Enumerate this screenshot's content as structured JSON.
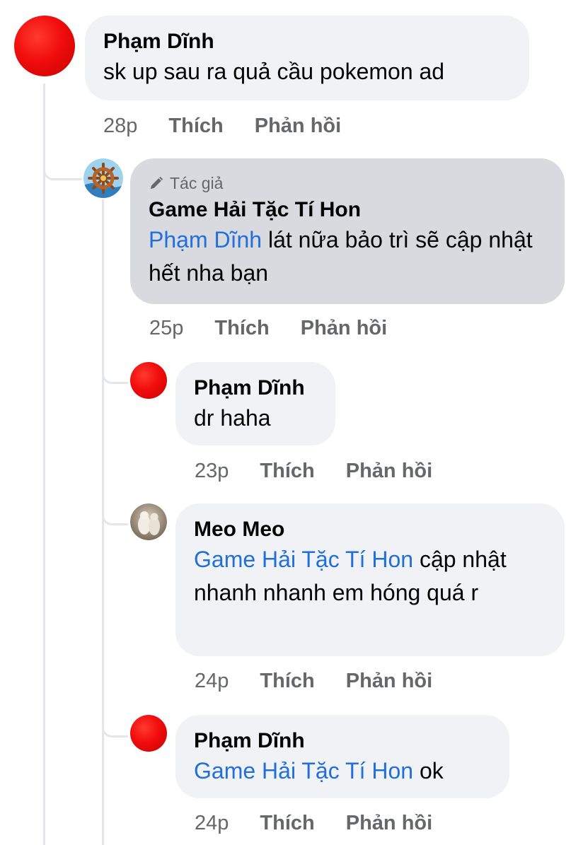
{
  "comments": [
    {
      "author": "Phạm Dĩnh",
      "text": "sk up sau ra quả cầu pokemon ad",
      "time": "28p",
      "like": "Thích",
      "reply": "Phản hồi"
    },
    {
      "badge": "Tác giả",
      "author": "Game Hải Tặc Tí Hon",
      "mention": "Phạm Dĩnh",
      "text": " lát nữa bảo trì sẽ cập nhật hết nha bạn",
      "time": "25p",
      "like": "Thích",
      "reply": "Phản hồi"
    },
    {
      "author": "Phạm Dĩnh",
      "text": "dr haha",
      "time": "23p",
      "like": "Thích",
      "reply": "Phản hồi"
    },
    {
      "author": "Meo Meo",
      "mention": "Game Hải Tặc Tí Hon",
      "text": " cập nhật nhanh nhanh em hóng quá r",
      "time": "24p",
      "like": "Thích",
      "reply": "Phản hồi"
    },
    {
      "author": "Phạm Dĩnh",
      "mention": "Game Hải Tặc Tí Hon",
      "text": " ok",
      "time": "24p",
      "like": "Thích",
      "reply": "Phản hồi"
    }
  ],
  "icons": {
    "badge": "pencil-icon",
    "page_avatar": "ship-wheel-logo",
    "user_avatar": "cat-photo"
  },
  "colors": {
    "bubble": "#f0f2f5",
    "author_bubble": "#d8dadf",
    "mention": "#216fdb",
    "meta": "#65676b",
    "avatar_red": "#f10d0d"
  }
}
